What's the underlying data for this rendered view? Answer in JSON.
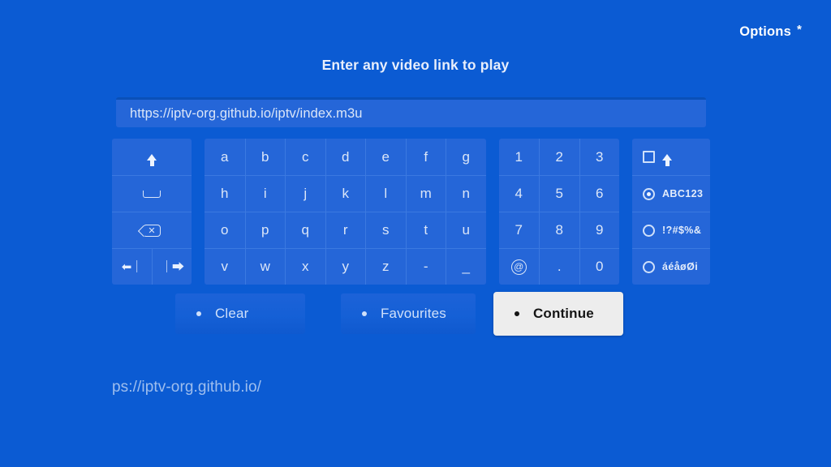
{
  "colors": {
    "background": "#0b5bd3",
    "panel": "#2566d8",
    "panel_divider": "#3b79e0",
    "key_text": "#dbe6f8",
    "continue_bg": "#ededed",
    "continue_text": "#151515"
  },
  "header": {
    "options_label": "Options",
    "options_marker": "*"
  },
  "heading": "Enter any video link to play",
  "url_input": {
    "value": "https://iptv-org.github.io/iptv/index.m3u",
    "placeholder": "Enter any video link to play"
  },
  "keyboard": {
    "modifiers": [
      {
        "name": "shift-key",
        "icon": "shift-icon",
        "label": ""
      },
      {
        "name": "space-key",
        "icon": "space-icon",
        "label": ""
      },
      {
        "name": "backspace-key",
        "icon": "backspace-icon",
        "label": ""
      },
      {
        "name": "cursor-left-key",
        "icon": "cursor-left-icon",
        "label": ""
      },
      {
        "name": "cursor-right-key",
        "icon": "cursor-right-icon",
        "label": ""
      }
    ],
    "letters": [
      [
        "a",
        "b",
        "c",
        "d",
        "e",
        "f",
        "g"
      ],
      [
        "h",
        "i",
        "j",
        "k",
        "l",
        "m",
        "n"
      ],
      [
        "o",
        "p",
        "q",
        "r",
        "s",
        "t",
        "u"
      ],
      [
        "v",
        "w",
        "x",
        "y",
        "z",
        "-",
        "_"
      ]
    ],
    "numbers": [
      [
        "1",
        "2",
        "3"
      ],
      [
        "4",
        "5",
        "6"
      ],
      [
        "7",
        "8",
        "9"
      ],
      [
        "@",
        ".",
        "0"
      ]
    ],
    "modes": [
      {
        "label": "",
        "control": "checkbox",
        "selected": false,
        "icon": "shift-arrow-icon"
      },
      {
        "label": "ABC123",
        "control": "radio",
        "selected": true
      },
      {
        "label": "!?#$%&",
        "control": "radio",
        "selected": false
      },
      {
        "label": "áéåøØi",
        "control": "radio",
        "selected": false
      }
    ]
  },
  "actions": [
    {
      "label": "Clear",
      "selected": false
    },
    {
      "label": "Favourites",
      "selected": false
    },
    {
      "label": "Continue",
      "selected": true
    }
  ],
  "suggestion": "ps://iptv-org.github.io/"
}
